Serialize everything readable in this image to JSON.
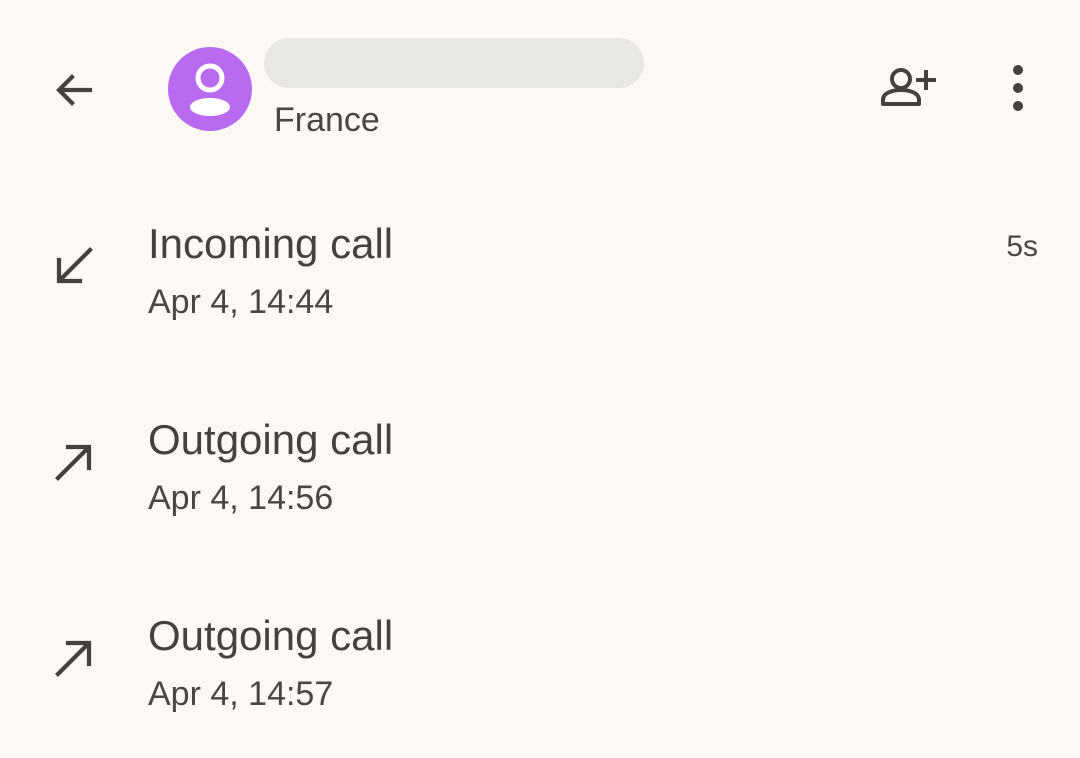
{
  "header": {
    "back_icon": "arrow-back-icon",
    "avatar_icon": "person-icon",
    "avatar_color": "#b86bf0",
    "subtitle": "France",
    "add_contact_icon": "person-add-icon",
    "more_icon": "more-vert-icon"
  },
  "calls": [
    {
      "type": "Incoming call",
      "time": "Apr 4, 14:44",
      "duration": "5s",
      "icon": "call-received-icon"
    },
    {
      "type": "Outgoing call",
      "time": "Apr 4, 14:56",
      "duration": "",
      "icon": "call-made-icon"
    },
    {
      "type": "Outgoing call",
      "time": "Apr 4, 14:57",
      "duration": "",
      "icon": "call-made-icon"
    }
  ]
}
